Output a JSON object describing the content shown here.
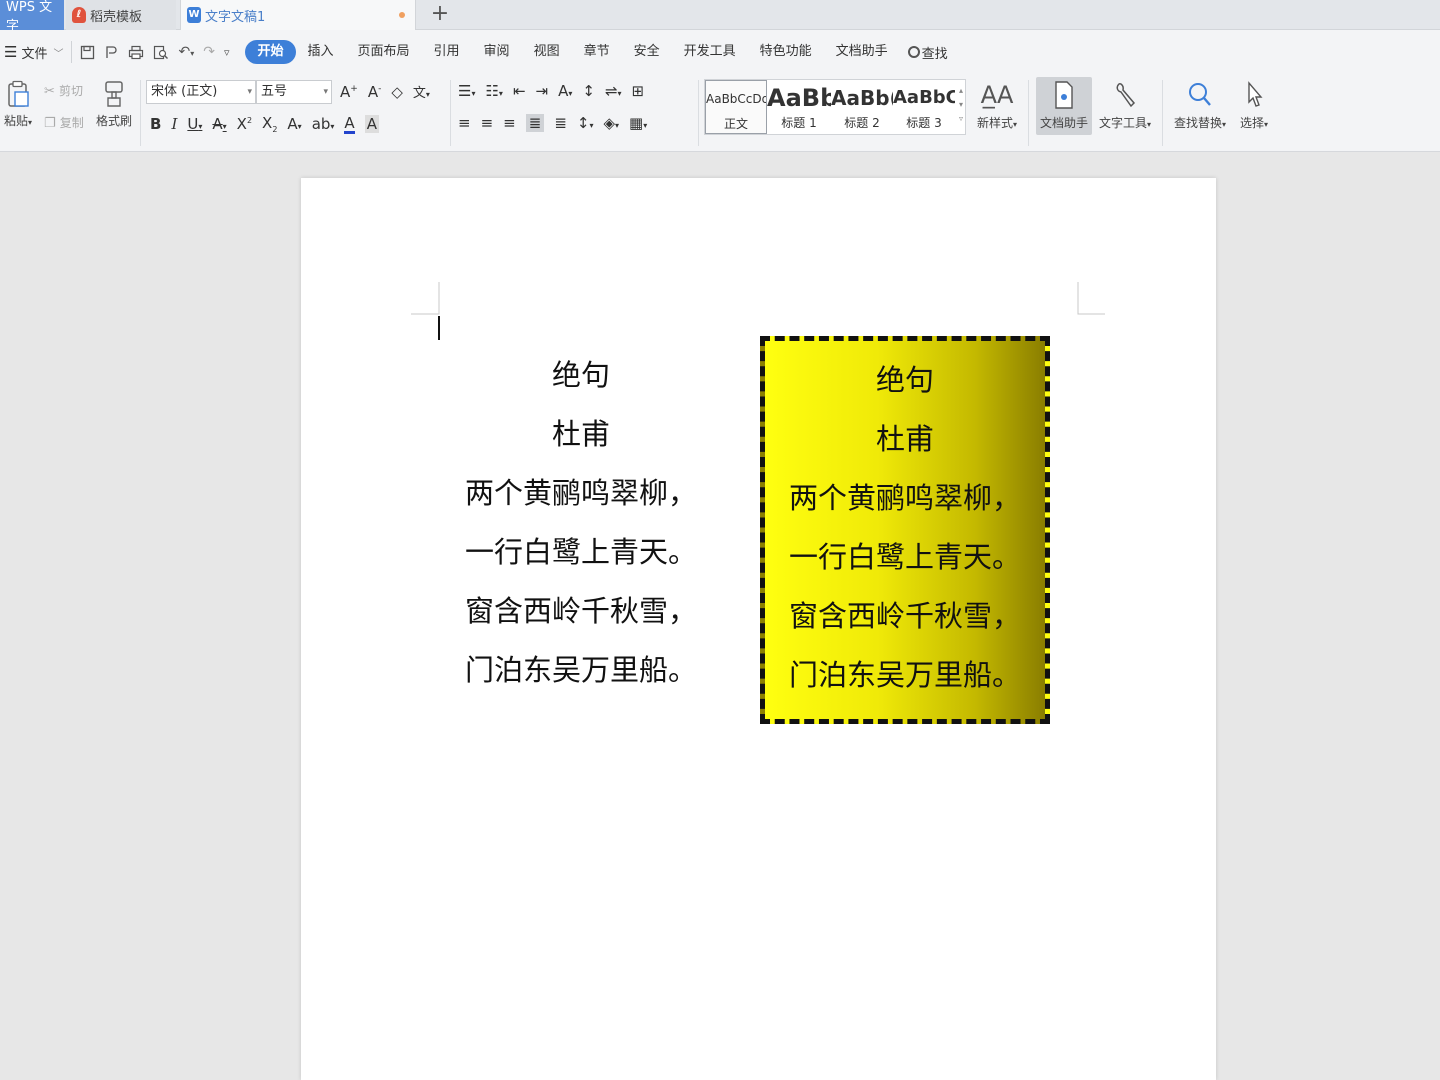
{
  "tabs": {
    "wps": "WPS 文字",
    "template": "稻壳模板",
    "document": "文字文稿1",
    "add": "+"
  },
  "menu": {
    "file": "文件",
    "tabs": [
      "开始",
      "插入",
      "页面布局",
      "引用",
      "审阅",
      "视图",
      "章节",
      "安全",
      "开发工具",
      "特色功能",
      "文档助手"
    ],
    "active_tab": "开始",
    "search": "查找"
  },
  "ribbon": {
    "paste": "粘贴",
    "cut": "剪切",
    "copy": "复制",
    "format_painter": "格式刷",
    "font_name": "宋体 (正文)",
    "font_size": "五号",
    "styles": [
      {
        "sample": "AaBbCcDd",
        "name": "正文"
      },
      {
        "sample": "AaBb",
        "name": "标题 1"
      },
      {
        "sample": "AaBb(",
        "name": "标题 2"
      },
      {
        "sample": "AaBbC(",
        "name": "标题 3"
      }
    ],
    "new_style": "新样式",
    "doc_helper": "文档助手",
    "text_tools": "文字工具",
    "find_replace": "查找替换",
    "select": "选择"
  },
  "document": {
    "poem_lines": [
      "绝句",
      "杜甫",
      "两个黄鹂鸣翠柳，",
      "一行白鹭上青天。",
      "窗含西岭千秋雪，",
      "门泊东吴万里船。"
    ]
  },
  "colors": {
    "accent": "#3d7fd8",
    "box_gradient_start": "#ffff10",
    "box_gradient_end": "#8a7e00",
    "box_border": "#111111"
  }
}
